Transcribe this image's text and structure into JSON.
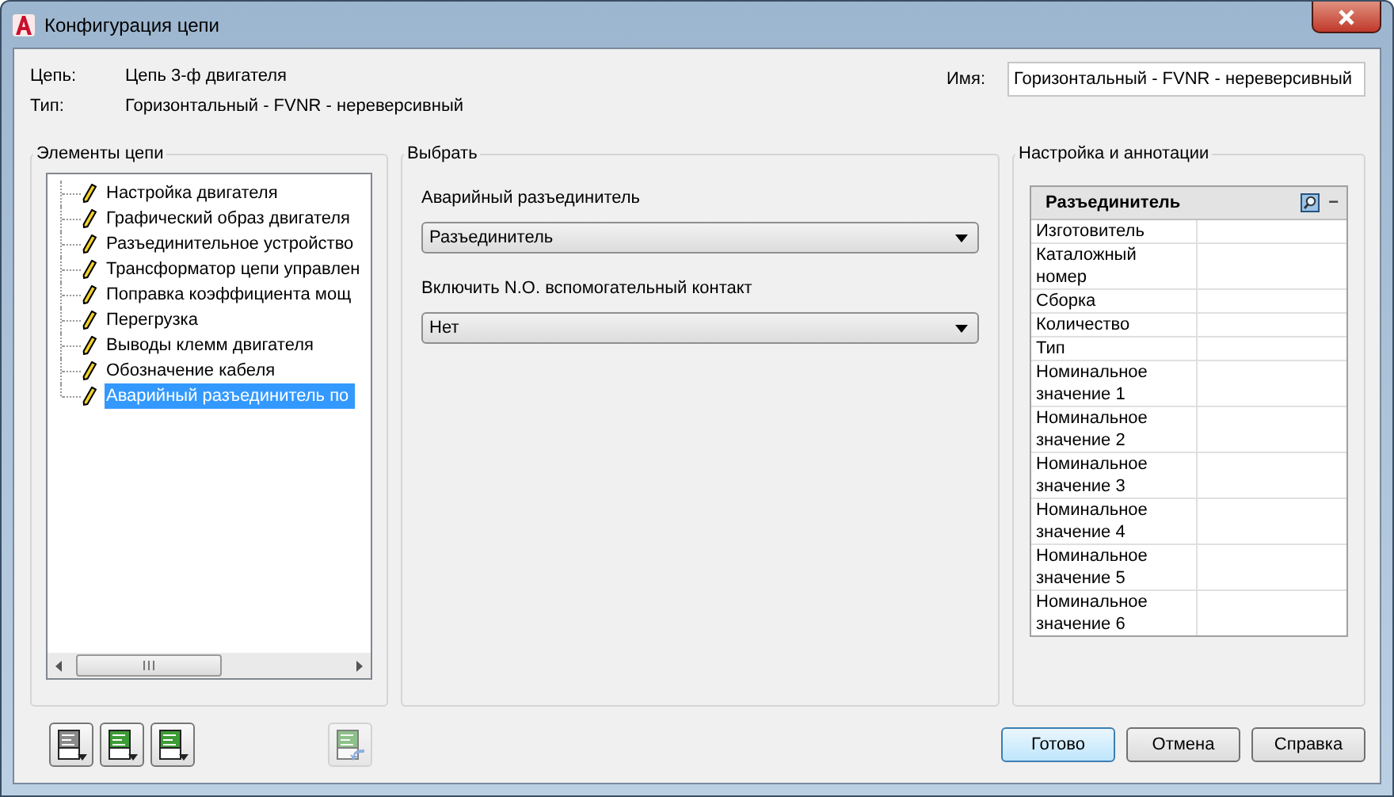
{
  "window": {
    "title": "Конфигурация цепи"
  },
  "info": [
    {
      "label": "Цепь:",
      "value": "Цепь 3-ф двигателя"
    },
    {
      "label": "Тип:",
      "value": "Горизонтальный - FVNR - нереверсивный"
    }
  ],
  "name_field": {
    "label": "Имя:",
    "value": "Горизонтальный - FVNR - нереверсивный"
  },
  "elements_panel": {
    "title": "Элементы цепи",
    "items": [
      {
        "label": "Настройка двигателя",
        "selected": false
      },
      {
        "label": "Графический образ двигателя",
        "selected": false
      },
      {
        "label": "Разъединительное устройство",
        "selected": false
      },
      {
        "label": "Трансформатор цепи управлен",
        "selected": false
      },
      {
        "label": "Поправка коэффициента мощ",
        "selected": false
      },
      {
        "label": "Перегрузка",
        "selected": false
      },
      {
        "label": "Выводы клемм двигателя",
        "selected": false
      },
      {
        "label": "Обозначение кабеля",
        "selected": false
      },
      {
        "label": "Аварийный разъединитель по",
        "selected": true
      }
    ]
  },
  "select_panel": {
    "title": "Выбрать",
    "fields": [
      {
        "label": "Аварийный разъединитель",
        "value": "Разъединитель"
      },
      {
        "label": "Включить N.O. вспомогательный контакт",
        "value": "Нет"
      }
    ]
  },
  "annotation_panel": {
    "title": "Настройка и аннотации",
    "grid_title": "Разъединитель",
    "collapse": "−",
    "properties": [
      "Изготовитель",
      "Каталожный номер",
      "Сборка",
      "Количество",
      "Тип",
      "Номинальное значение 1",
      "Номинальное значение 2",
      "Номинальное значение 3",
      "Номинальное значение 4",
      "Номинальное значение 5",
      "Номинальное значение 6"
    ]
  },
  "tool_buttons": [
    {
      "disabled": false
    },
    {
      "disabled": false
    },
    {
      "disabled": false
    },
    {
      "disabled": true
    }
  ],
  "buttons": [
    {
      "label": "Готово",
      "default": true
    },
    {
      "label": "Отмена",
      "default": false
    },
    {
      "label": "Справка",
      "default": false
    }
  ]
}
